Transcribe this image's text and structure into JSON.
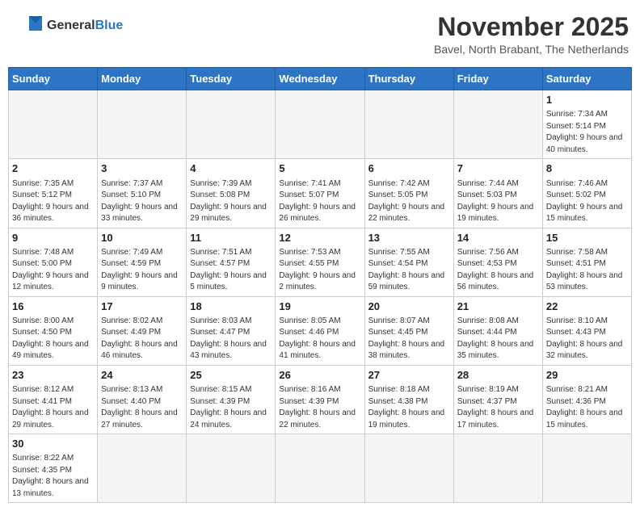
{
  "header": {
    "logo_general": "General",
    "logo_blue": "Blue",
    "month": "November 2025",
    "location": "Bavel, North Brabant, The Netherlands"
  },
  "days_of_week": [
    "Sunday",
    "Monday",
    "Tuesday",
    "Wednesday",
    "Thursday",
    "Friday",
    "Saturday"
  ],
  "weeks": [
    [
      {
        "day": "",
        "info": ""
      },
      {
        "day": "",
        "info": ""
      },
      {
        "day": "",
        "info": ""
      },
      {
        "day": "",
        "info": ""
      },
      {
        "day": "",
        "info": ""
      },
      {
        "day": "",
        "info": ""
      },
      {
        "day": "1",
        "info": "Sunrise: 7:34 AM\nSunset: 5:14 PM\nDaylight: 9 hours and 40 minutes."
      }
    ],
    [
      {
        "day": "2",
        "info": "Sunrise: 7:35 AM\nSunset: 5:12 PM\nDaylight: 9 hours and 36 minutes."
      },
      {
        "day": "3",
        "info": "Sunrise: 7:37 AM\nSunset: 5:10 PM\nDaylight: 9 hours and 33 minutes."
      },
      {
        "day": "4",
        "info": "Sunrise: 7:39 AM\nSunset: 5:08 PM\nDaylight: 9 hours and 29 minutes."
      },
      {
        "day": "5",
        "info": "Sunrise: 7:41 AM\nSunset: 5:07 PM\nDaylight: 9 hours and 26 minutes."
      },
      {
        "day": "6",
        "info": "Sunrise: 7:42 AM\nSunset: 5:05 PM\nDaylight: 9 hours and 22 minutes."
      },
      {
        "day": "7",
        "info": "Sunrise: 7:44 AM\nSunset: 5:03 PM\nDaylight: 9 hours and 19 minutes."
      },
      {
        "day": "8",
        "info": "Sunrise: 7:46 AM\nSunset: 5:02 PM\nDaylight: 9 hours and 15 minutes."
      }
    ],
    [
      {
        "day": "9",
        "info": "Sunrise: 7:48 AM\nSunset: 5:00 PM\nDaylight: 9 hours and 12 minutes."
      },
      {
        "day": "10",
        "info": "Sunrise: 7:49 AM\nSunset: 4:59 PM\nDaylight: 9 hours and 9 minutes."
      },
      {
        "day": "11",
        "info": "Sunrise: 7:51 AM\nSunset: 4:57 PM\nDaylight: 9 hours and 5 minutes."
      },
      {
        "day": "12",
        "info": "Sunrise: 7:53 AM\nSunset: 4:55 PM\nDaylight: 9 hours and 2 minutes."
      },
      {
        "day": "13",
        "info": "Sunrise: 7:55 AM\nSunset: 4:54 PM\nDaylight: 8 hours and 59 minutes."
      },
      {
        "day": "14",
        "info": "Sunrise: 7:56 AM\nSunset: 4:53 PM\nDaylight: 8 hours and 56 minutes."
      },
      {
        "day": "15",
        "info": "Sunrise: 7:58 AM\nSunset: 4:51 PM\nDaylight: 8 hours and 53 minutes."
      }
    ],
    [
      {
        "day": "16",
        "info": "Sunrise: 8:00 AM\nSunset: 4:50 PM\nDaylight: 8 hours and 49 minutes."
      },
      {
        "day": "17",
        "info": "Sunrise: 8:02 AM\nSunset: 4:49 PM\nDaylight: 8 hours and 46 minutes."
      },
      {
        "day": "18",
        "info": "Sunrise: 8:03 AM\nSunset: 4:47 PM\nDaylight: 8 hours and 43 minutes."
      },
      {
        "day": "19",
        "info": "Sunrise: 8:05 AM\nSunset: 4:46 PM\nDaylight: 8 hours and 41 minutes."
      },
      {
        "day": "20",
        "info": "Sunrise: 8:07 AM\nSunset: 4:45 PM\nDaylight: 8 hours and 38 minutes."
      },
      {
        "day": "21",
        "info": "Sunrise: 8:08 AM\nSunset: 4:44 PM\nDaylight: 8 hours and 35 minutes."
      },
      {
        "day": "22",
        "info": "Sunrise: 8:10 AM\nSunset: 4:43 PM\nDaylight: 8 hours and 32 minutes."
      }
    ],
    [
      {
        "day": "23",
        "info": "Sunrise: 8:12 AM\nSunset: 4:41 PM\nDaylight: 8 hours and 29 minutes."
      },
      {
        "day": "24",
        "info": "Sunrise: 8:13 AM\nSunset: 4:40 PM\nDaylight: 8 hours and 27 minutes."
      },
      {
        "day": "25",
        "info": "Sunrise: 8:15 AM\nSunset: 4:39 PM\nDaylight: 8 hours and 24 minutes."
      },
      {
        "day": "26",
        "info": "Sunrise: 8:16 AM\nSunset: 4:39 PM\nDaylight: 8 hours and 22 minutes."
      },
      {
        "day": "27",
        "info": "Sunrise: 8:18 AM\nSunset: 4:38 PM\nDaylight: 8 hours and 19 minutes."
      },
      {
        "day": "28",
        "info": "Sunrise: 8:19 AM\nSunset: 4:37 PM\nDaylight: 8 hours and 17 minutes."
      },
      {
        "day": "29",
        "info": "Sunrise: 8:21 AM\nSunset: 4:36 PM\nDaylight: 8 hours and 15 minutes."
      }
    ],
    [
      {
        "day": "30",
        "info": "Sunrise: 8:22 AM\nSunset: 4:35 PM\nDaylight: 8 hours and 13 minutes."
      },
      {
        "day": "",
        "info": ""
      },
      {
        "day": "",
        "info": ""
      },
      {
        "day": "",
        "info": ""
      },
      {
        "day": "",
        "info": ""
      },
      {
        "day": "",
        "info": ""
      },
      {
        "day": "",
        "info": ""
      }
    ]
  ]
}
